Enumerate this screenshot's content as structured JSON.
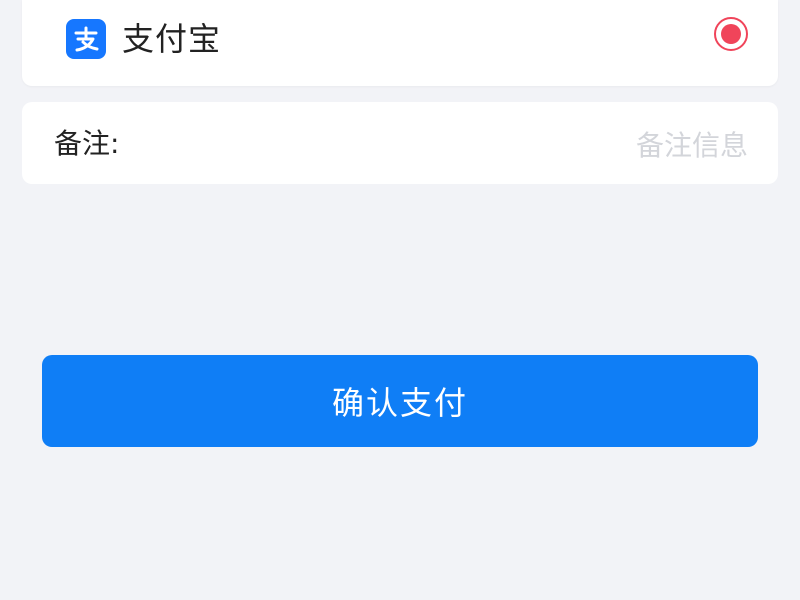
{
  "payment_method": {
    "name": "支付宝",
    "logo_icon": "alipay-icon",
    "selected": true,
    "accent_color": "#f0445a",
    "brand_color": "#1677ff"
  },
  "remark": {
    "label": "备注:",
    "placeholder": "备注信息",
    "value": ""
  },
  "confirm_button": {
    "label": "确认支付",
    "color": "#0f7ef6"
  }
}
